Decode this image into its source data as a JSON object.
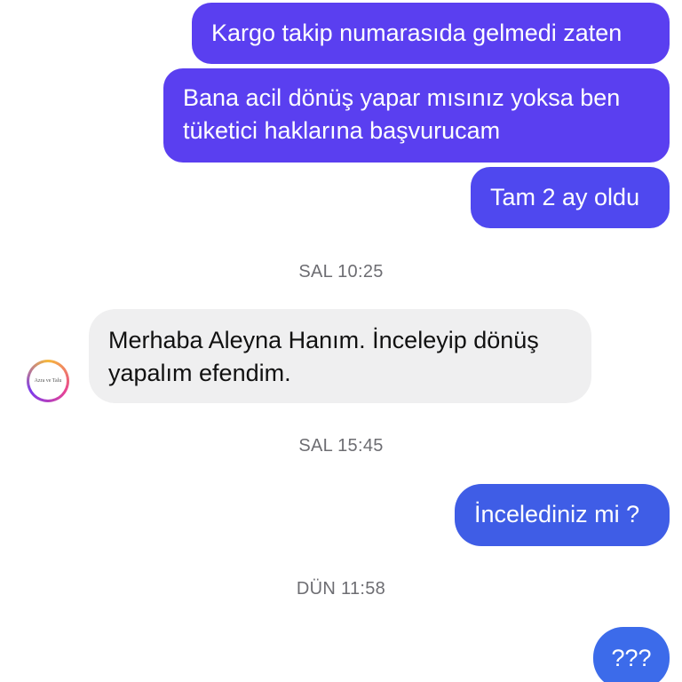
{
  "messages": [
    {
      "id": "m1",
      "direction": "outgoing",
      "lines": [
        "Kargo takip numarasıda gelmedi zaten"
      ]
    },
    {
      "id": "m2",
      "direction": "outgoing",
      "lines": [
        "Bana acil dönüş yapar mısınız yoksa ben",
        "tüketici haklarına başvurucam"
      ]
    },
    {
      "id": "m3",
      "direction": "outgoing",
      "lines": [
        "Tam 2 ay oldu"
      ]
    },
    {
      "id": "m4",
      "direction": "incoming",
      "lines": [
        "Merhaba Aleyna Hanım. İnceleyip dönüş",
        "yapalım efendim."
      ]
    },
    {
      "id": "m5",
      "direction": "outgoing",
      "lines": [
        "İncelediniz mi ?"
      ]
    },
    {
      "id": "m6",
      "direction": "outgoing",
      "lines": [
        "???"
      ]
    }
  ],
  "timestamps": [
    "SAL 10:25",
    "SAL 15:45",
    "DÜN 11:58"
  ],
  "contact": {
    "avatar_text": "Azra ve Talu"
  },
  "colors": {
    "outgoing_top": "#5a3ff0",
    "outgoing_bottom": "#3c6bea",
    "incoming_bg": "#efeff0",
    "timestamp_text": "#6d6d72"
  }
}
